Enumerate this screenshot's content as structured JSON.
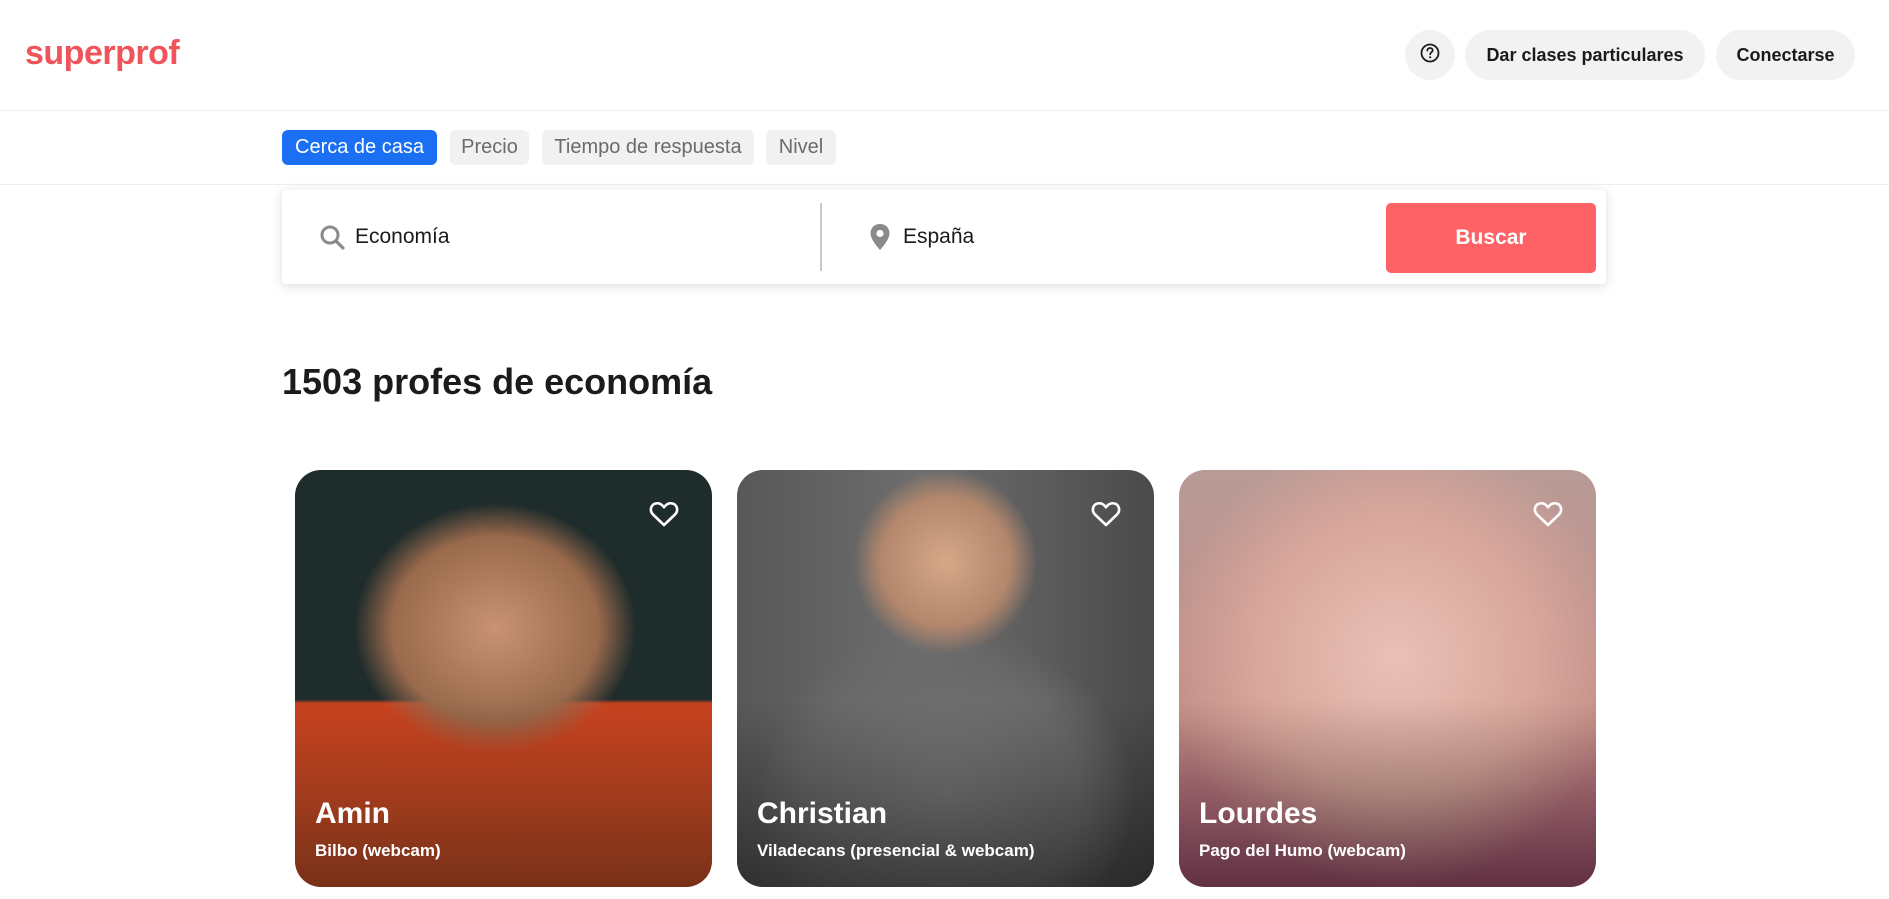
{
  "header": {
    "logo": "superprof",
    "help_icon": "question-circle-icon",
    "teach_label": "Dar clases particulares",
    "login_label": "Conectarse"
  },
  "filters": [
    {
      "label": "Cerca de casa",
      "active": true
    },
    {
      "label": "Precio",
      "active": false
    },
    {
      "label": "Tiempo de respuesta",
      "active": false
    },
    {
      "label": "Nivel",
      "active": false
    }
  ],
  "search": {
    "subject_value": "Economía",
    "subject_icon": "search-icon",
    "location_value": "España",
    "location_icon": "location-pin-icon",
    "button_label": "Buscar"
  },
  "results": {
    "title": "1503 profes de economía"
  },
  "cards": [
    {
      "name": "Amin",
      "location": "Bilbo (webcam)",
      "favorite_icon": "heart-outline-icon"
    },
    {
      "name": "Christian",
      "location": "Viladecans (presencial & webcam)",
      "favorite_icon": "heart-outline-icon"
    },
    {
      "name": "Lourdes",
      "location": "Pago del Humo (webcam)",
      "favorite_icon": "heart-outline-icon"
    }
  ],
  "colors": {
    "brand": "#f0545a",
    "accent_blue": "#1a6ff3",
    "search_button": "#ff6266"
  }
}
